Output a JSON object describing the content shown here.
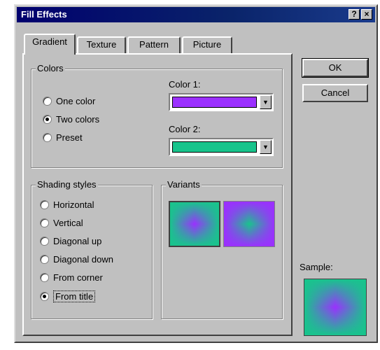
{
  "dialog": {
    "title": "Fill Effects",
    "help_button": "?",
    "close_button": "×"
  },
  "tabs": [
    {
      "label": "Gradient",
      "active": true
    },
    {
      "label": "Texture"
    },
    {
      "label": "Pattern"
    },
    {
      "label": "Picture"
    }
  ],
  "colors": {
    "group_label": "Colors",
    "options": [
      "One color",
      "Two colors",
      "Preset"
    ],
    "selected": "Two colors",
    "color1_label": "Color 1:",
    "color1_value": "#9b30ff",
    "color2_label": "Color 2:",
    "color2_value": "#18c48c"
  },
  "shading": {
    "group_label": "Shading styles",
    "options": [
      "Horizontal",
      "Vertical",
      "Diagonal up",
      "Diagonal down",
      "From corner",
      "From title"
    ],
    "selected": "From title"
  },
  "variants": {
    "group_label": "Variants",
    "items": [
      {
        "outer": "#18c48c",
        "inner": "#9b30ff",
        "selected": true
      },
      {
        "outer": "#9b30ff",
        "inner": "#18c48c",
        "selected": false
      }
    ]
  },
  "buttons": {
    "ok": "OK",
    "cancel": "Cancel"
  },
  "sample": {
    "label": "Sample:",
    "outer": "#18c48c",
    "inner": "#9b30ff"
  }
}
